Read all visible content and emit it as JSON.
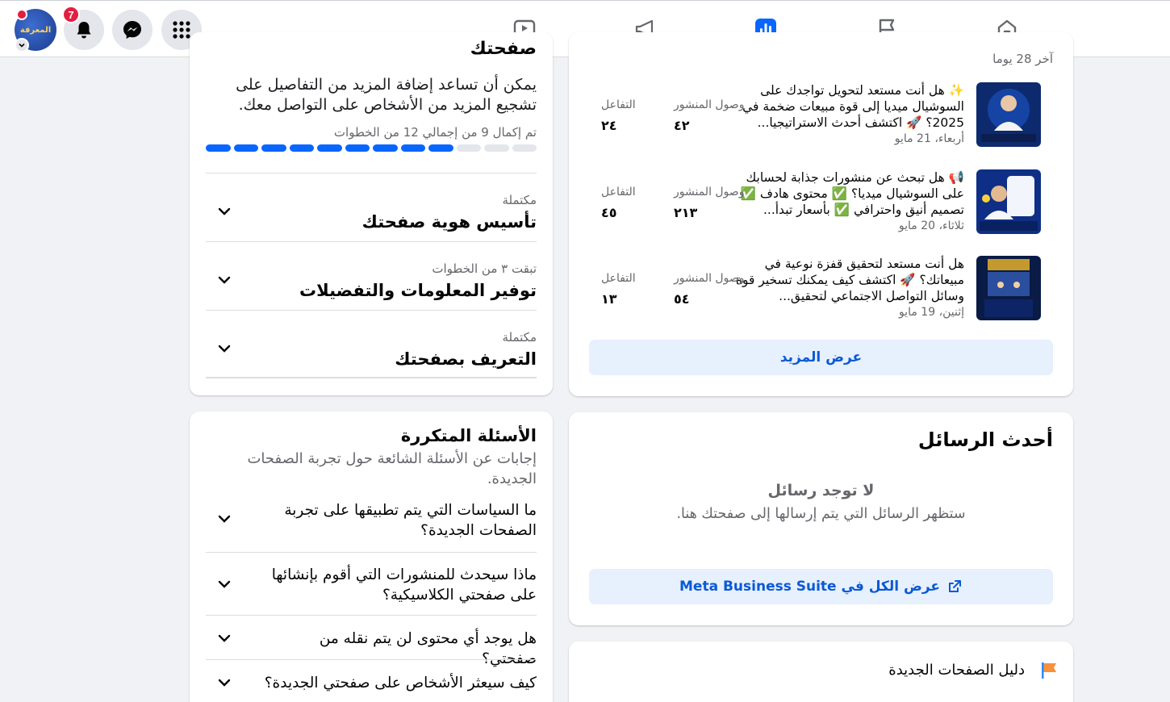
{
  "topbar": {
    "notifications_count": "7",
    "avatar_text": "المعرفة",
    "tabs": [
      "home",
      "pages",
      "insights",
      "ads",
      "video"
    ]
  },
  "setup": {
    "title": "صفحتك",
    "description": "يمكن أن تساعد إضافة المزيد من التفاصيل على تشجيع المزيد من الأشخاص على التواصل معك.",
    "progress_text": "تم إكمال 9 من إجمالي 12 من الخطوات",
    "progress_done": 9,
    "progress_total": 12,
    "steps": [
      {
        "status": "مكتملة",
        "title": "تأسيس هوية صفحتك"
      },
      {
        "status": "تبقت ٣ من الخطوات",
        "title": "توفير المعلومات والتفضيلات"
      },
      {
        "status": "مكتملة",
        "title": "التعريف بصفحتك"
      }
    ]
  },
  "posts": {
    "period": "آخر 28 يوما",
    "reach_label": "وصول المنشور",
    "engagement_label": "التفاعل",
    "items": [
      {
        "text": "✨ هل أنت مستعد لتحويل تواجدك على السوشيال ميديا إلى قوة مبيعات ضخمة في 2025؟ 🚀 اكتشف أحدث الاستراتيجيا...",
        "date": "أربعاء، 21 مايو",
        "reach": "٤٢",
        "engagement": "٢٤"
      },
      {
        "text": "📢 هل تبحث عن منشورات جذابة لحسابك على السوشيال ميديا؟ ✅ محتوى هادف ✅ تصميم أنيق واحترافي ✅ بأسعار تبدأ...",
        "date": "ثلاثاء، 20 مايو",
        "reach": "٢١٣",
        "engagement": "٤٥"
      },
      {
        "text": "هل أنت مستعد لتحقيق قفزة نوعية في مبيعاتك؟ 🚀 اكتشف كيف يمكنك تسخير قوة وسائل التواصل الاجتماعي لتحقيق...",
        "date": "إثنين، 19 مايو",
        "reach": "٥٤",
        "engagement": "١٣"
      }
    ],
    "see_more": "عرض المزيد"
  },
  "faq": {
    "title": "الأسئلة المتكررة",
    "description": "إجابات عن الأسئلة الشائعة حول تجربة الصفحات الجديدة.",
    "questions": [
      "ما السياسات التي يتم تطبيقها على تجربة الصفحات الجديدة؟",
      "ماذا سيحدث للمنشورات التي أقوم بإنشائها على صفحتي الكلاسيكية؟",
      "هل يوجد أي محتوى لن يتم نقله من صفحتي؟",
      "كيف سيعثر الأشخاص على صفحتي الجديدة؟"
    ]
  },
  "messages": {
    "title": "أحدث الرسائل",
    "empty_title": "لا توجد رسائل",
    "empty_sub": "ستظهر الرسائل التي يتم إرسالها إلى صفحتك هنا.",
    "view_all": "عرض الكل في Meta Business Suite"
  },
  "guide": {
    "title": "دليل الصفحات الجديدة"
  },
  "colors": {
    "accent": "#0866ff",
    "badge": "#e41e3f",
    "button_bg": "#e7f0fd"
  }
}
